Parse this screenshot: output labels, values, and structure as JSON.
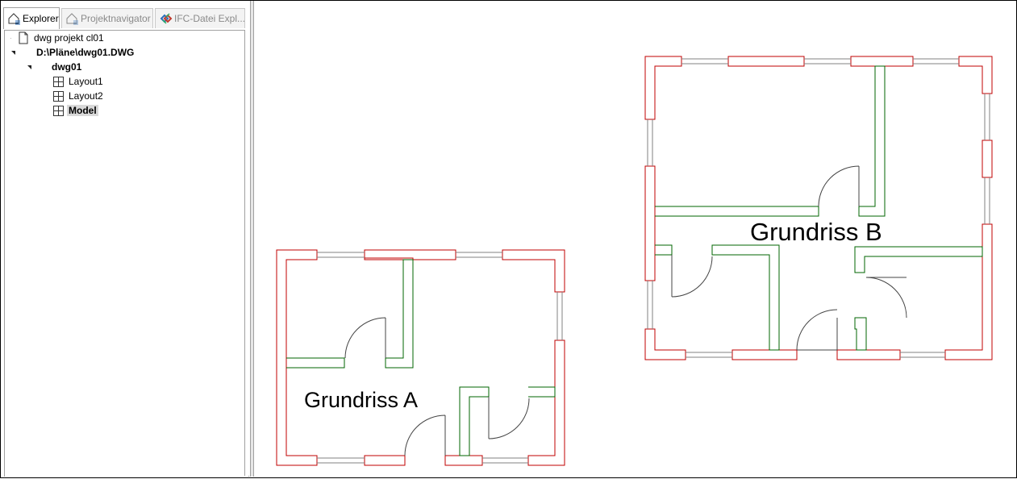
{
  "tabs": [
    {
      "label": "Explorer",
      "active": true
    },
    {
      "label": "Projektnavigator",
      "active": false
    },
    {
      "label": "IFC-Datei Expl...",
      "active": false
    }
  ],
  "tree": {
    "project": "dwg projekt cl01",
    "file": "D:\\Pläne\\dwg01.DWG",
    "drawing": "dwg01",
    "items": [
      "Layout1",
      "Layout2",
      "Model"
    ],
    "selected": "Model"
  },
  "drawing": {
    "label_a": "Grundriss A",
    "label_b": "Grundriss B",
    "colors": {
      "outer_wall": "#c00000",
      "inner_wall": "#006600",
      "window": "#808080",
      "door": "#444444"
    }
  }
}
